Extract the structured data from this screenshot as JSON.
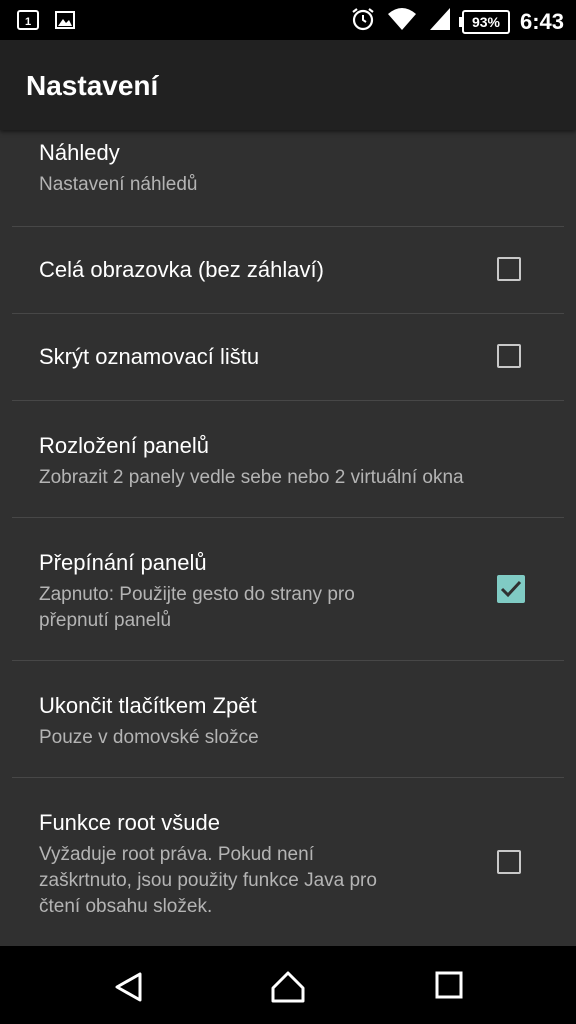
{
  "status_bar": {
    "icons_left": [
      "sim-1-icon",
      "image-icon"
    ],
    "icons_right": [
      "alarm-icon",
      "wifi-icon",
      "signal-icon"
    ],
    "battery": "93%",
    "time": "6:43"
  },
  "app_bar": {
    "title": "Nastavení"
  },
  "settings": [
    {
      "title": "Náhledy",
      "subtitle": "Nastavení náhledů",
      "checkbox": null
    },
    {
      "title": "Celá obrazovka (bez záhlaví)",
      "subtitle": "",
      "checkbox": false
    },
    {
      "title": "Skrýt oznamovací lištu",
      "subtitle": "",
      "checkbox": false
    },
    {
      "title": "Rozložení panelů",
      "subtitle": "Zobrazit 2 panely vedle sebe nebo 2 virtuální okna",
      "checkbox": null
    },
    {
      "title": "Přepínání panelů",
      "subtitle_lines": [
        "Zapnuto: Použijte gesto do strany pro",
        "přepnutí panelů"
      ],
      "checkbox": true
    },
    {
      "title": "Ukončit tlačítkem Zpět",
      "subtitle": "Pouze v domovské složce",
      "checkbox": null
    },
    {
      "title": "Funkce root všude",
      "subtitle_lines": [
        "Vyžaduje root práva. Pokud není",
        "zaškrtnuto, jsou použity funkce Java pro",
        "čtení obsahu složek."
      ],
      "checkbox": false
    }
  ],
  "nav_bar": {
    "buttons": [
      "back-icon",
      "home-icon",
      "recents-icon"
    ]
  },
  "colors": {
    "accent": "#80cbc4",
    "background": "#303030",
    "app_bar": "#212121"
  }
}
